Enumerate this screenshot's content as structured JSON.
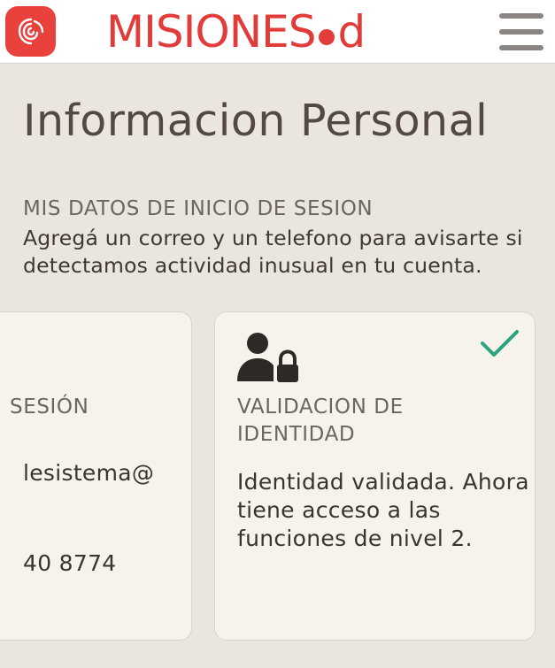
{
  "header": {
    "logo_text_main": "MISIONES",
    "logo_text_suffix": "d",
    "brand_color": "#e23c3a",
    "app_icon": "fingerprint-icon",
    "menu_icon": "hamburger-menu-icon"
  },
  "page": {
    "title": "Informacion Personal"
  },
  "login_section": {
    "label": "MIS DATOS DE INICIO DE SESION",
    "description": "Agregá un correo y un telefono para avisarte si detectamos actividad inusual en tu cuenta."
  },
  "cards": {
    "left": {
      "heading": "SESIÓN",
      "email_fragment": "lesistema@",
      "phone_fragment": "40 8774"
    },
    "right": {
      "icon": "user-lock-icon",
      "status_icon": "check-icon",
      "status_color": "#2aa37e",
      "heading": "VALIDACION DE IDENTIDAD",
      "text": "Identidad validada. Ahora tiene acceso a las funciones de nivel 2."
    }
  }
}
